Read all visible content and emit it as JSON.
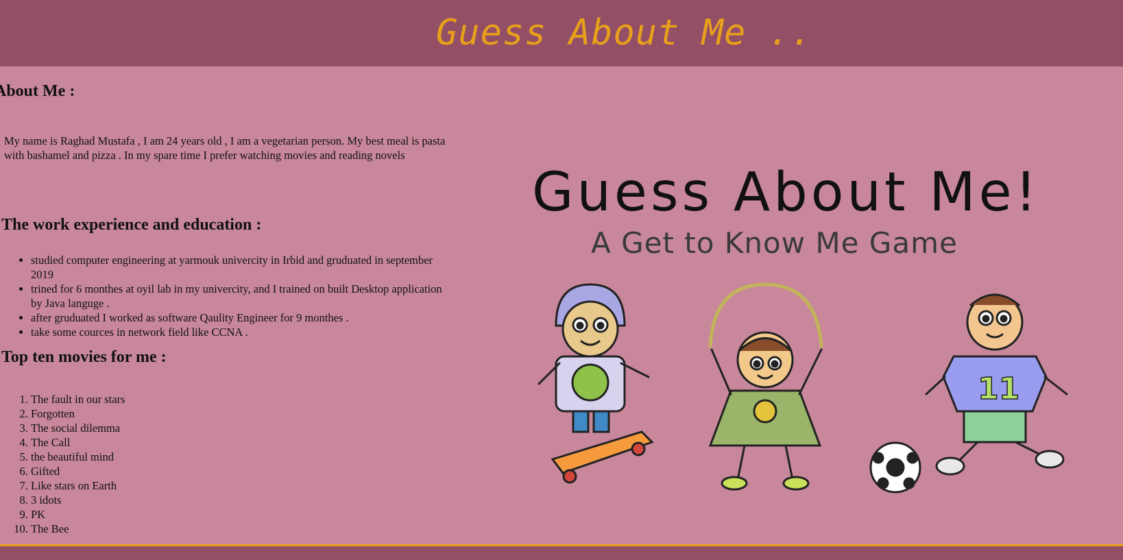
{
  "header": {
    "title": "Guess About Me .."
  },
  "about": {
    "heading": "About Me :",
    "text": "My name is Raghad Mustafa , I am 24 years old , I am a vegetarian person. My best meal is pasta with bashamel and pizza . In my spare time I prefer watching movies and reading novels"
  },
  "work": {
    "heading": "The work experience and education :",
    "items": [
      "studied computer engineering at yarmouk univercity in Irbid and gruduated in september 2019",
      "trined for 6 monthes at oyil lab in my univercity, and I trained on built Desktop application by Java languge .",
      "after gruduated I worked as software Qaulity Engineer for 9 monthes .",
      "take some cources in network field like CCNA ."
    ]
  },
  "movies": {
    "heading": "Top ten movies for me :",
    "items": [
      "The fault in our stars",
      "Forgotten",
      "The social dilemma",
      "The Call",
      "the beautiful mind",
      "Gifted",
      "Like stars on Earth",
      "3 idots",
      "PK",
      "The Bee"
    ]
  },
  "hero": {
    "title": "Guess About Me!",
    "subtitle": "A Get to Know Me Game",
    "jersey_number": "11"
  },
  "colors": {
    "header_bg": "#924f66",
    "page_bg": "#c8879a",
    "title_accent": "#e8a01b"
  }
}
